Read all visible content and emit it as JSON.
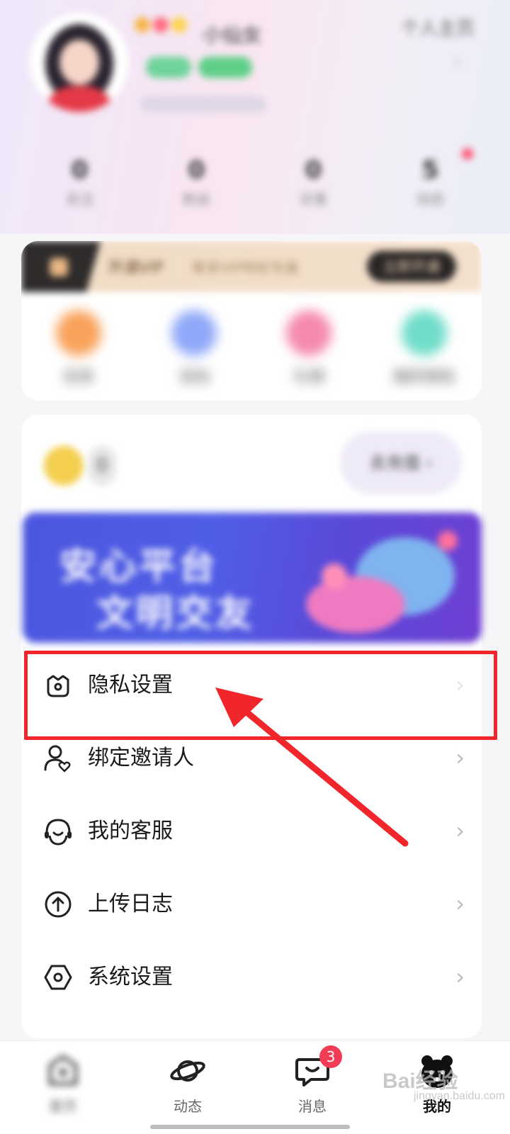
{
  "profile": {
    "nickname": "小仙女",
    "top_link": "个人主页"
  },
  "stats": [
    {
      "num": "0",
      "label": "关注"
    },
    {
      "num": "0",
      "label": "粉丝"
    },
    {
      "num": "0",
      "label": "访客"
    },
    {
      "num": "5",
      "label": "动态"
    }
  ],
  "vip": {
    "title": "开通VIP",
    "desc": "尊享VIP特权专属",
    "button": "立即开通"
  },
  "quick": [
    {
      "label": "任务",
      "color": "#f9a25b"
    },
    {
      "label": "活动",
      "color": "#8fa8f8"
    },
    {
      "label": "礼物",
      "color": "#f68aae"
    },
    {
      "label": "我的钱包",
      "color": "#6fddc9"
    }
  ],
  "wallet": {
    "coin_count": "0",
    "recharge": "去充值 ›"
  },
  "banner": {
    "line1": "安心平台",
    "line2": "文明交友"
  },
  "menu": [
    {
      "label": "隐私设置",
      "icon": "privacy-icon"
    },
    {
      "label": "绑定邀请人",
      "icon": "bind-inviter-icon"
    },
    {
      "label": "我的客服",
      "icon": "customer-service-icon"
    },
    {
      "label": "上传日志",
      "icon": "upload-log-icon"
    },
    {
      "label": "系统设置",
      "icon": "system-settings-icon"
    }
  ],
  "chevron": "›",
  "nav": [
    {
      "label": "首页",
      "icon": "home-icon"
    },
    {
      "label": "动态",
      "icon": "planet-icon"
    },
    {
      "label": "消息",
      "icon": "message-icon",
      "badge": "3"
    },
    {
      "label": "我的",
      "icon": "profile-icon"
    }
  ],
  "watermark": {
    "text": "Bai经验",
    "sub": "jingyan.baidu.com"
  },
  "colors": {
    "annotation": "#f0262b",
    "badge": "#f23c55"
  }
}
